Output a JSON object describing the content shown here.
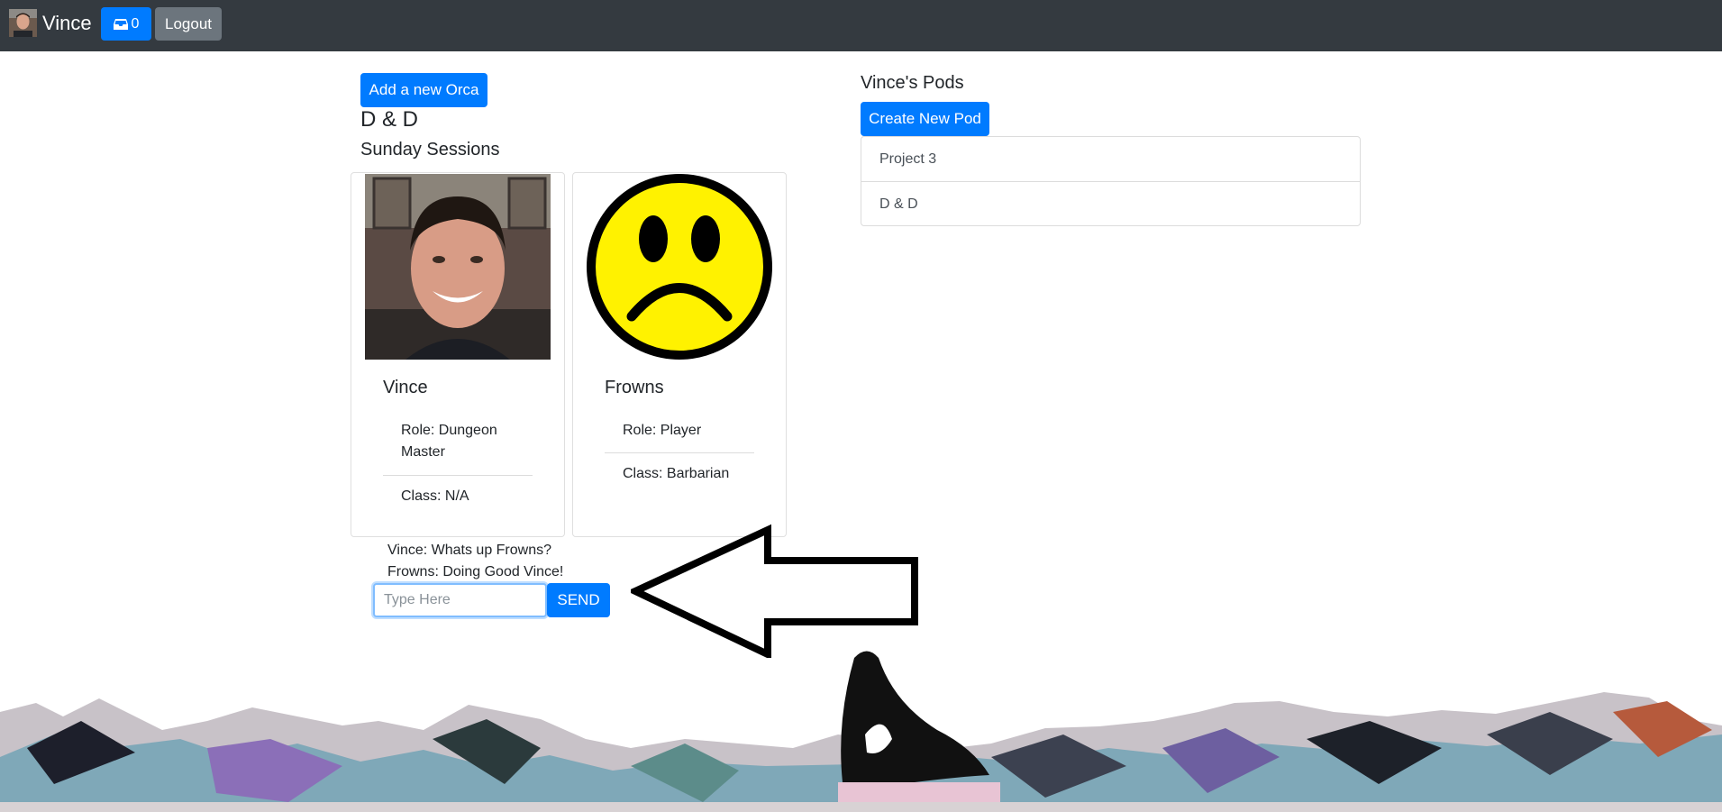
{
  "navbar": {
    "user_name": "Vince",
    "inbox_count": "0",
    "logout_label": "Logout"
  },
  "main": {
    "add_orca_label": "Add a new Orca",
    "pod_title": "D & D",
    "pod_subtitle": "Sunday Sessions",
    "members": [
      {
        "name": "Vince",
        "role": "Role: Dungeon Master",
        "class": "Class: N/A"
      },
      {
        "name": "Frowns",
        "role": "Role: Player",
        "class": "Class: Barbarian"
      }
    ],
    "chat": {
      "messages": [
        "Vince: Whats up Frowns?",
        "Frowns: Doing Good Vince!"
      ],
      "placeholder": "Type Here",
      "send_label": "SEND"
    }
  },
  "sidebar": {
    "heading": "Vince's Pods",
    "create_label": "Create New Pod",
    "pods": [
      "Project 3",
      "D & D"
    ]
  },
  "colors": {
    "navbar": "#343a40",
    "primary": "#007bff",
    "secondary": "#6c757d",
    "smiley": "#fff200"
  }
}
